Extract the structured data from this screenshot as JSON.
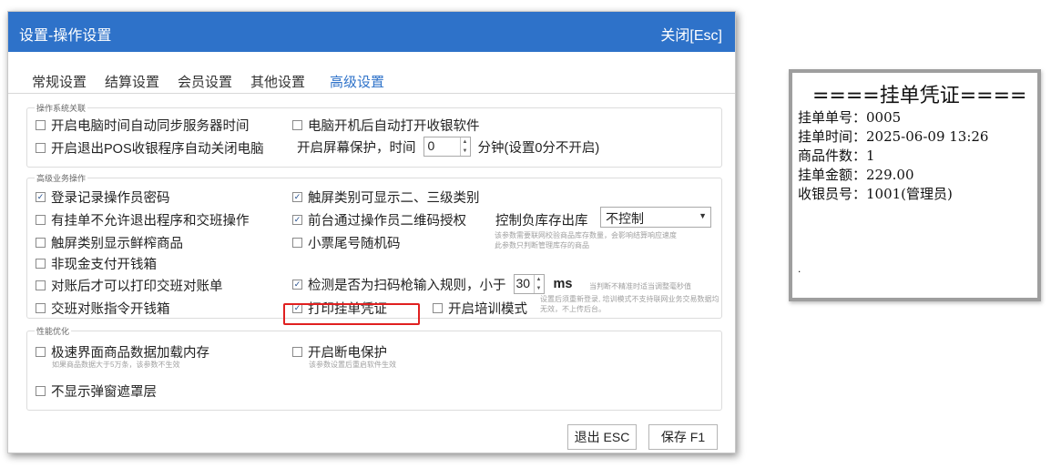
{
  "dialog": {
    "title": "设置-操作设置",
    "close_label": "关闭[Esc]",
    "tabs": [
      "常规设置",
      "结算设置",
      "会员设置",
      "其他设置",
      "高级设置"
    ],
    "active_tab": "高级设置",
    "group_os": {
      "legend": "操作系统关联",
      "sync_time": {
        "label": "开启电脑时间自动同步服务器时间",
        "checked": false
      },
      "auto_open": {
        "label": "电脑开机后自动打开收银软件",
        "checked": false
      },
      "shutdown_on_exit": {
        "label": "开启退出POS收银程序自动关闭电脑",
        "checked": false
      },
      "screensaver_label": "开启屏幕保护，时间",
      "screensaver_value": "0",
      "screensaver_suffix": "分钟(设置0分不开启)"
    },
    "group_business": {
      "legend": "高级业务操作",
      "login_record": {
        "label": "登录记录操作员密码",
        "checked": true
      },
      "touch_category": {
        "label": "触屏类别可显示二、三级类别",
        "checked": true
      },
      "suspend_no_exit": {
        "label": "有挂单不允许退出程序和交班操作",
        "checked": false
      },
      "qr_auth": {
        "label": "前台通过操作员二维码授权",
        "checked": true
      },
      "stock_label": "控制负库存出库",
      "stock_select": "不控制",
      "stock_hint": [
        "该参数需要联网校验商品库存数量，会影响结算响应速度",
        "此参数只判断管理库存的商品"
      ],
      "touch_fresh": {
        "label": "触屏类别显示鲜榨商品",
        "checked": false
      },
      "ticket_random": {
        "label": "小票尾号随机码",
        "checked": false
      },
      "non_cash_drawer": {
        "label": "非现金支付开钱箱",
        "checked": false
      },
      "reconcile_print": {
        "label": "对账后才可以打印交班对账单",
        "checked": false
      },
      "scanner_detect": {
        "label": "检测是否为扫码枪输入规则，小于",
        "checked": true
      },
      "scanner_value": "30",
      "scanner_unit": "ms",
      "scanner_hint": "当判断不精准时适当调整毫秒值",
      "shift_drawer": {
        "label": "交班对账指令开钱箱",
        "checked": false
      },
      "print_suspend": {
        "label": "打印挂单凭证",
        "checked": true
      },
      "training_mode": {
        "label": "开启培训模式",
        "checked": false
      },
      "training_hint": "设置后须重新登录, 培训模式不支持联网业务交易数据均无效，不上传后台。"
    },
    "group_perf": {
      "legend": "性能优化",
      "fast_load": {
        "label": "极速界面商品数据加载内存",
        "checked": false
      },
      "fast_load_hint": "如果商品数据大于5万条，该参数不生效",
      "power_protect": {
        "label": "开启断电保护",
        "checked": false
      },
      "power_protect_hint": "该参数设置后重启软件生效",
      "no_mask": {
        "label": "不显示弹窗遮罩层",
        "checked": false
      }
    },
    "exit_button": "退出 ESC",
    "save_button": "保存 F1"
  },
  "receipt": {
    "title": "====挂单凭证====",
    "lines": [
      "挂单单号：0005",
      "挂单时间：2025-06-09 13:26",
      "商品件数：1",
      "挂单金额：229.00",
      "收银员号：1001(管理员)"
    ],
    "end_mark": "."
  },
  "colors": {
    "accent": "#2e72c9",
    "highlight": "#e02020"
  }
}
